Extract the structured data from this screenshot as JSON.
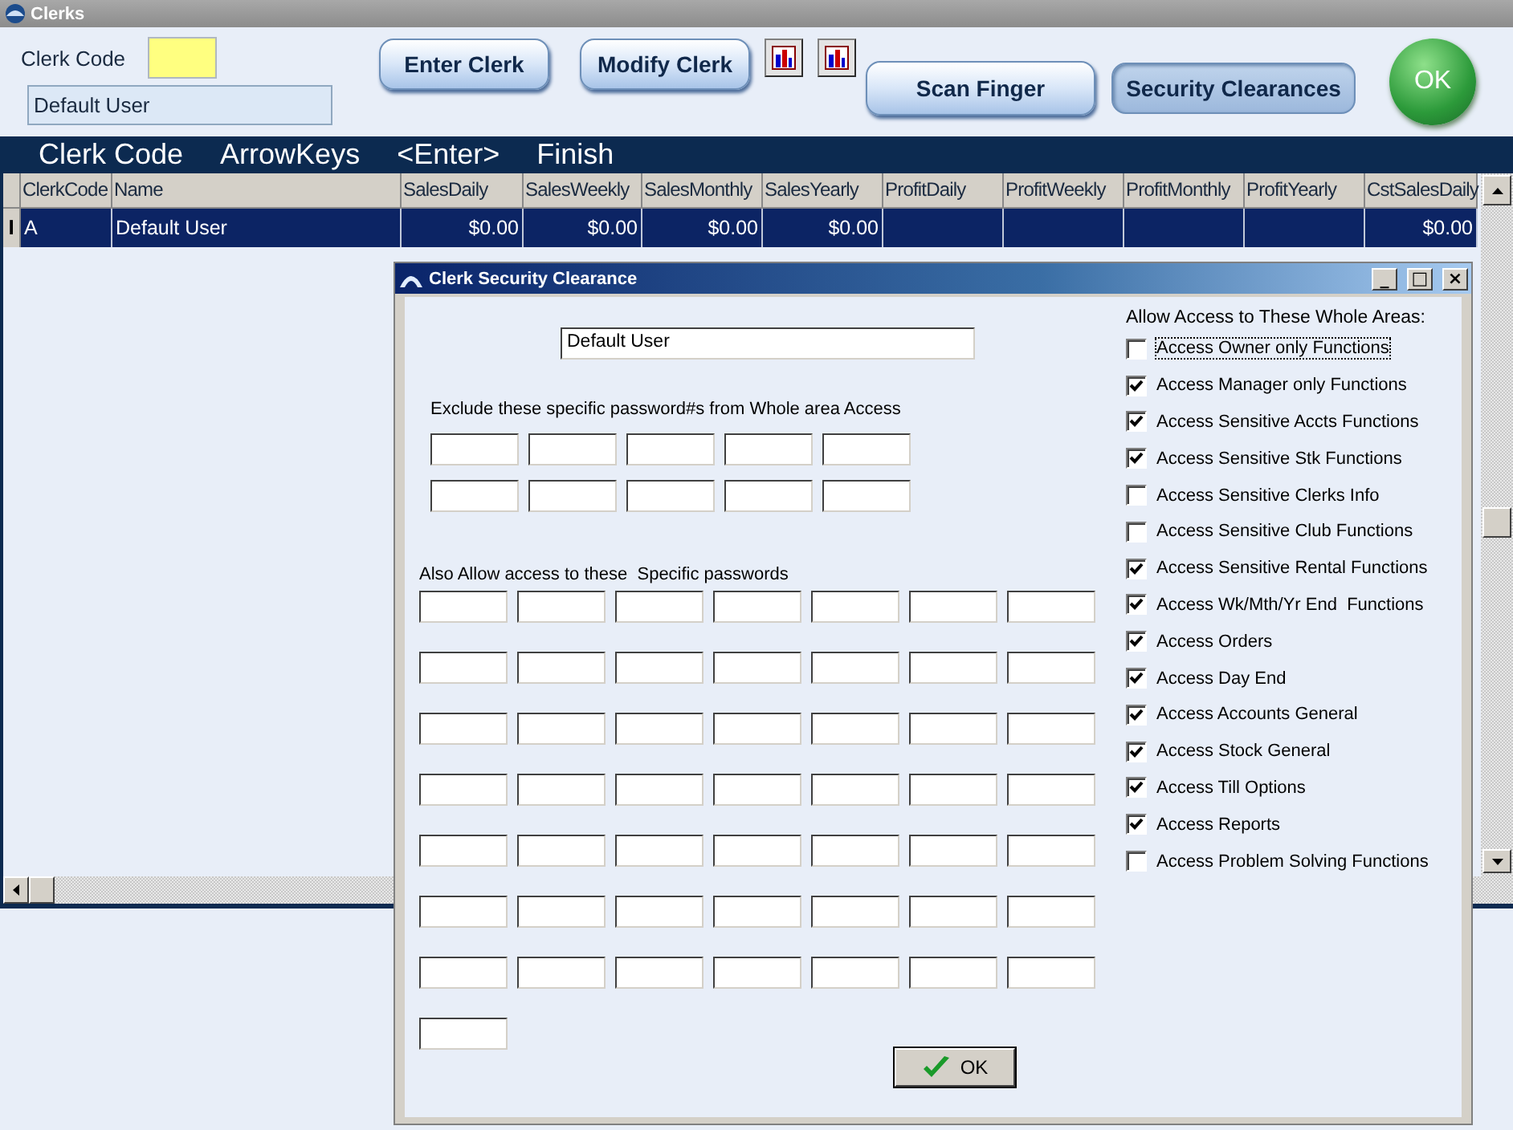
{
  "window": {
    "title": "Clerks"
  },
  "clerk_code": {
    "label": "Clerk Code"
  },
  "clerk_name": {
    "value": "Default User"
  },
  "buttons": [
    {
      "kind": "text",
      "label": "Enter Clerk",
      "pressed": false
    },
    {
      "kind": "text",
      "label": "Modify Clerk",
      "pressed": false
    },
    {
      "kind": "chart",
      "pressed": false
    },
    {
      "kind": "chart",
      "pressed": false
    },
    {
      "kind": "text",
      "label": "Scan Finger",
      "pressed": false
    },
    {
      "kind": "text",
      "label": "Security Clearances",
      "pressed": true
    },
    {
      "kind": "round",
      "label": "OK",
      "pressed": false
    }
  ],
  "hint_bar": [
    "Clerk Code",
    "ArrowKeys",
    "<Enter>",
    "Finish"
  ],
  "table": {
    "columns": [
      "ClerkCode",
      "Name",
      "SalesDaily",
      "SalesWeekly",
      "SalesMonthly",
      "SalesYearly",
      "ProfitDaily",
      "ProfitWeekly",
      "ProfitMonthly",
      "ProfitYearly",
      "CstSalesDaily"
    ],
    "rows": [
      {
        "marker": "I",
        "selected": true,
        "cells": [
          "A",
          "Default User",
          "$0.00",
          "$0.00",
          "$0.00",
          "$0.00",
          null,
          null,
          null,
          null,
          "$0.00"
        ]
      }
    ]
  },
  "dialog": {
    "title": "Clerk Security Clearance",
    "window_buttons": [
      "_",
      "□",
      "×"
    ],
    "name_value": "Default User",
    "exclude_label": "Exclude these specific password#s from Whole area Access",
    "allow_label": "Also Allow access to these  Specific passwords",
    "areas_label": "Allow Access to These Whole Areas:",
    "areas": [
      {
        "label": "Access Owner only Functions",
        "checked": false,
        "focused": true
      },
      {
        "label": "Access Manager only Functions",
        "checked": true,
        "focused": false
      },
      {
        "label": "Access Sensitive Accts Functions",
        "checked": true,
        "focused": false
      },
      {
        "label": "Access Sensitive Stk Functions",
        "checked": true,
        "focused": false
      },
      {
        "label": "Access Sensitive Clerks Info",
        "checked": false,
        "focused": false
      },
      {
        "label": "Access Sensitive Club Functions",
        "checked": false,
        "focused": false
      },
      {
        "label": "Access Sensitive Rental Functions",
        "checked": true,
        "focused": false
      },
      {
        "label": "Access Wk/Mth/Yr End  Functions",
        "checked": true,
        "focused": false
      },
      {
        "label": "Access Orders",
        "checked": true,
        "focused": false
      },
      {
        "label": "Access Day End",
        "checked": true,
        "focused": false
      },
      {
        "label": "Access Accounts General",
        "checked": true,
        "focused": false
      },
      {
        "label": "Access Stock General",
        "checked": true,
        "focused": false
      },
      {
        "label": "Access Till Options",
        "checked": true,
        "focused": false
      },
      {
        "label": "Access Reports",
        "checked": true,
        "focused": false
      },
      {
        "label": "Access Problem Solving Functions",
        "checked": false,
        "focused": false
      }
    ],
    "ok_button": "OK"
  }
}
